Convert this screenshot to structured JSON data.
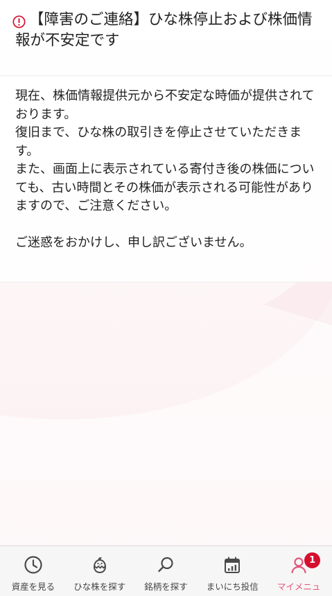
{
  "notice": {
    "title": "【障害のご連絡】ひな株停止および株価情報が不安定です",
    "alert_icon": "exclamation-circle-icon",
    "body_paragraph_1": "現在、株価情報提供元から不安定な時価が提供されております。",
    "body_paragraph_2": "復旧まで、ひな株の取引きを停止させていただきます。",
    "body_paragraph_3": "また、画面上に表示されている寄付き後の株価についても、古い時間とその株価が表示される可能性がありますので、ご注意ください。",
    "body_paragraph_4": "ご迷惑をおかけし、申し訳ございません。"
  },
  "tabbar": {
    "tabs": [
      {
        "label": "資産を見る",
        "icon": "clock-icon"
      },
      {
        "label": "ひな株を探す",
        "icon": "chick-icon"
      },
      {
        "label": "銘柄を探す",
        "icon": "search-icon"
      },
      {
        "label": "まいにち投信",
        "icon": "calendar-icon"
      },
      {
        "label": "マイメニュ",
        "icon": "user-icon"
      }
    ],
    "badge_count": "1"
  },
  "colors": {
    "accent": "#e2557a",
    "alert": "#d50f2e",
    "badge": "#d50f2e"
  }
}
